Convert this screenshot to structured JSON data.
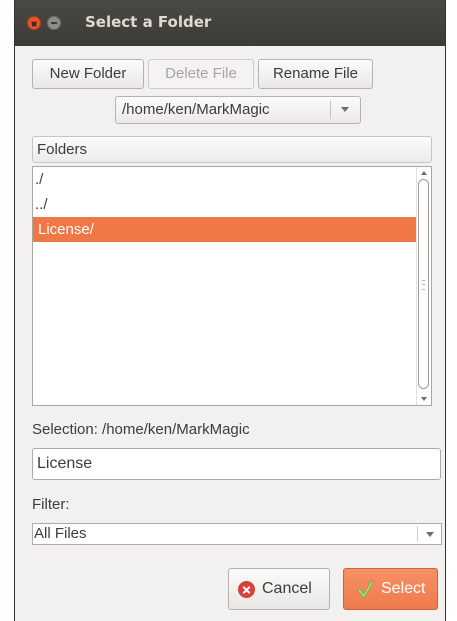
{
  "window": {
    "title": "Select a Folder"
  },
  "toolbar": {
    "new_folder": "New Folder",
    "delete_file": "Delete File",
    "rename_file": "Rename File"
  },
  "path_combo": {
    "value": "/home/ken/MarkMagic"
  },
  "folders": {
    "header": "Folders",
    "items": [
      {
        "label": "./",
        "selected": false
      },
      {
        "label": "../",
        "selected": false
      },
      {
        "label": "License/",
        "selected": true
      }
    ]
  },
  "selection": {
    "label": "Selection: /home/ken/MarkMagic",
    "value": "License"
  },
  "filter": {
    "label": "Filter:",
    "value": "All Files"
  },
  "actions": {
    "cancel": "Cancel",
    "select": "Select"
  },
  "colors": {
    "titlebar": "#3c3b37",
    "selected_row": "#f07746",
    "select_button": "#f48458"
  },
  "icons": {
    "close": "close-icon",
    "minimize": "minimize-icon",
    "cancel": "cancel-icon",
    "select": "check-icon",
    "dropdown": "chevron-down-icon"
  }
}
